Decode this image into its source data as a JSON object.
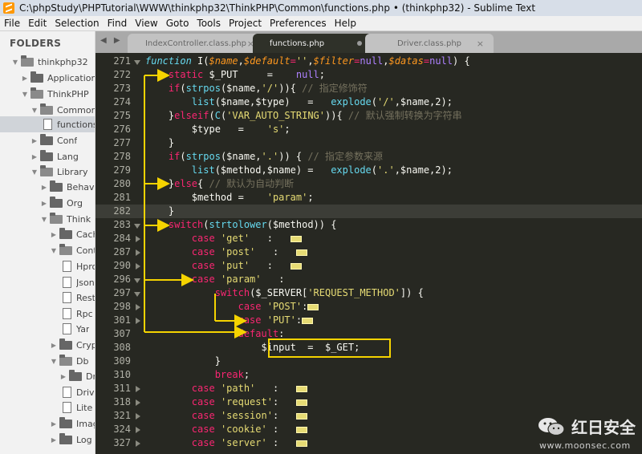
{
  "window": {
    "title": "C:\\phpStudy\\PHPTutorial\\WWW\\thinkphp32\\ThinkPHP\\Common\\functions.php • (thinkphp32) - Sublime Text"
  },
  "menu": [
    "File",
    "Edit",
    "Selection",
    "Find",
    "View",
    "Goto",
    "Tools",
    "Project",
    "Preferences",
    "Help"
  ],
  "sidebar": {
    "title": "FOLDERS",
    "items": [
      {
        "label": "thinkphp32"
      },
      {
        "label": "Application"
      },
      {
        "label": "ThinkPHP"
      },
      {
        "label": "Common"
      },
      {
        "label": "functions.php"
      },
      {
        "label": "Conf"
      },
      {
        "label": "Lang"
      },
      {
        "label": "Library"
      },
      {
        "label": "Behavior"
      },
      {
        "label": "Org"
      },
      {
        "label": "Think"
      },
      {
        "label": "Cache"
      },
      {
        "label": "Controller"
      },
      {
        "label": "Hprose"
      },
      {
        "label": "Json"
      },
      {
        "label": "Rest"
      },
      {
        "label": "Rpc"
      },
      {
        "label": "Yar"
      },
      {
        "label": "Crypt"
      },
      {
        "label": "Db"
      },
      {
        "label": "Driver"
      },
      {
        "label": "Driver.class.php"
      },
      {
        "label": "Lite"
      },
      {
        "label": "Image"
      },
      {
        "label": "Log"
      }
    ]
  },
  "tabs": [
    {
      "label": "IndexController.class.php"
    },
    {
      "label": "functions.php"
    },
    {
      "label": "Driver.class.php"
    }
  ],
  "tab_nav": "◀ ▶",
  "tab_close": "×",
  "code": {
    "line_numbers": [
      "271",
      "272",
      "273",
      "274",
      "275",
      "276",
      "277",
      "278",
      "279",
      "280",
      "281",
      "282",
      "283",
      "284",
      "287",
      "290",
      "296",
      "297",
      "298",
      "301",
      "307",
      "308",
      "309",
      "310",
      "311",
      "318",
      "321",
      "324",
      "327"
    ],
    "tokens": {
      "function": "function",
      "fn_name": "I(",
      "p_name": "$name",
      "comma": ",",
      "p_default": "$default",
      "eq": "=",
      "empty_str": "''",
      "p_filter": "$filter",
      "null": "null",
      "p_datas": "$datas",
      "sig_end": ") {",
      "static": "static",
      "put_decl": " $_PUT     =    ",
      "semi": ";",
      "if": "if",
      "strpos": "strpos",
      "slash_str": "'/'",
      "cm_modifier": "// 指定修饰符",
      "list": "list",
      "list1_args": "($name,$type)   =   ",
      "explode": "explode",
      "exp1_args": ",$name,2);",
      "elseif": "elseif",
      "C": "C",
      "var_auto": "'VAR_AUTO_STRING'",
      "cm_force": "// 默认强制转换为字符串",
      "type_assign": "    $type   =    ",
      "s_str": "'s'",
      "brace": "}",
      "dot_str": "'.'",
      "cm_source": "// 指定参数来源",
      "list2_args": "($method,$name) =   ",
      "else": "else",
      "cm_auto": "// 默认为自动判断",
      "method_assign": "    $method =    ",
      "param_str": "'param'",
      "switch": "switch",
      "strtolower": "strtolower",
      "method_arg": "($method)) {",
      "case": "case",
      "get_str": "'get'",
      "post_str": "'post'",
      "put_str": "'put'",
      "colon": "   :   ",
      "server": "($_SERVER[",
      "request_method": "'REQUEST_METHOD'",
      "server_end": "]) {",
      "POST_str": "'POST'",
      "PUT_str": "'PUT'",
      "default": "default",
      "input_line": "$input  =  $_GET;",
      "break": "break",
      "path_str": "'path'",
      "request_str": "'request'",
      "session_str": "'session'",
      "cookie_str": "'cookie'",
      "server_str": "'server'"
    }
  },
  "watermark": {
    "brand": "红日安全",
    "site": "www.moonsec.com"
  },
  "colors": {
    "editor_bg": "#272822",
    "annotation": "#f5d300",
    "keyword": "#f92672",
    "string": "#e6db74",
    "function": "#66d9ef",
    "comment": "#75715e"
  }
}
